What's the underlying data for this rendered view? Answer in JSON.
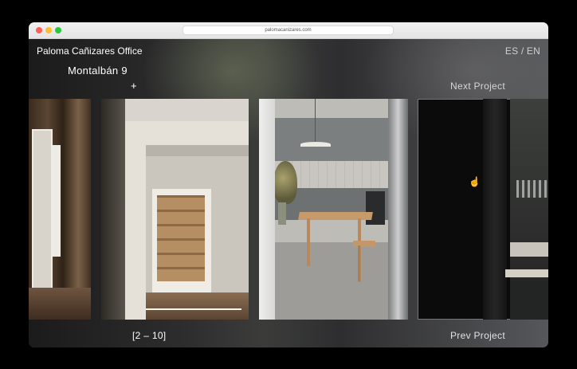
{
  "browser": {
    "url": "palomacanizares.com"
  },
  "site": {
    "brand": "Paloma Cañizares Office",
    "language_switch": "ES / EN"
  },
  "project": {
    "title": "Montalbán 9",
    "expand_symbol": "+",
    "counter": "[2 – 10]"
  },
  "nav": {
    "next": "Next Project",
    "prev": "Prev Project"
  },
  "gallery": {
    "images": [
      {
        "name": "interior-doorway-left"
      },
      {
        "name": "hallway-shelving-doorway"
      },
      {
        "name": "kitchen-dining-table"
      },
      {
        "name": "bathroom-dark-detail"
      }
    ]
  },
  "colors": {
    "accent_red": "#fe5f57",
    "accent_yellow": "#febc2e",
    "accent_green": "#28c840"
  }
}
